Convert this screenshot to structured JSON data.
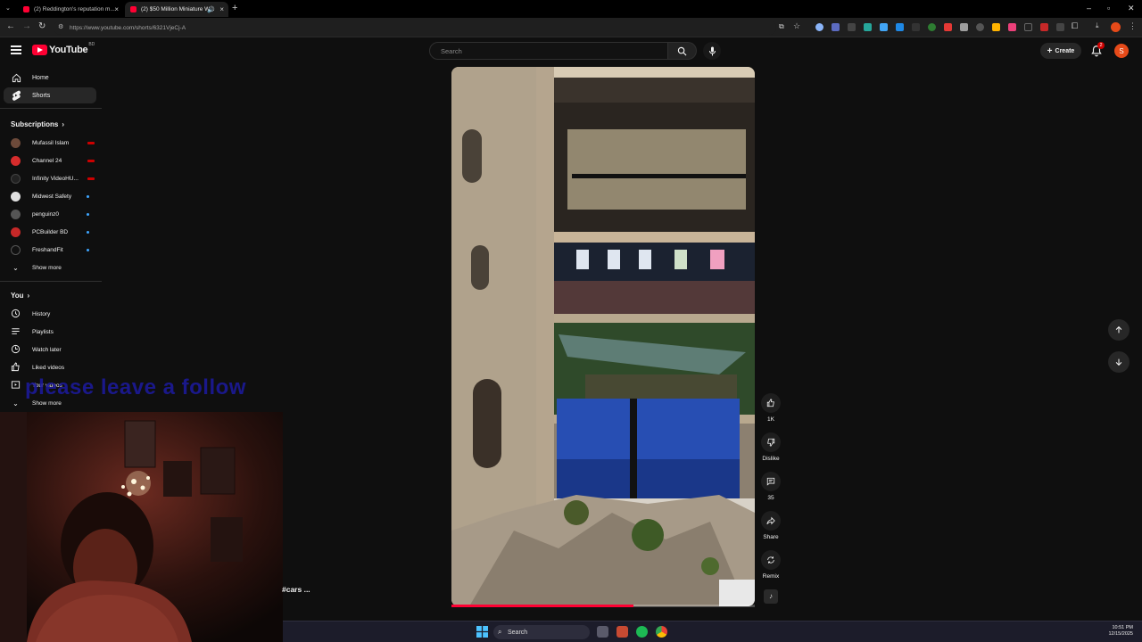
{
  "browser": {
    "tabs": [
      {
        "title": "(2) Reddington's reputation m...",
        "active": false
      },
      {
        "title": "(2) $50 Million Miniature W...",
        "active": true
      }
    ],
    "url": "https://www.youtube.com/shorts/6321VjeCj-A"
  },
  "masthead": {
    "logo_text": "YouTube",
    "country_code": "BD",
    "search_placeholder": "Search",
    "create_label": "Create",
    "notification_count": "2",
    "avatar_letter": "S"
  },
  "sidebar": {
    "main": [
      {
        "label": "Home",
        "icon": "home-icon",
        "active": false
      },
      {
        "label": "Shorts",
        "icon": "shorts-icon",
        "active": true
      }
    ],
    "subscriptions_title": "Subscriptions",
    "subscriptions": [
      {
        "name": "Mufassil Islam",
        "indicator": "live",
        "color": "#6d4a3a"
      },
      {
        "name": "Channel 24",
        "indicator": "live",
        "color": "#d62c2c"
      },
      {
        "name": "Infinity VideoHU...",
        "indicator": "live",
        "color": "#222222"
      },
      {
        "name": "Midwest Safety",
        "indicator": "dot",
        "color": "#e0e0e0"
      },
      {
        "name": "penguinz0",
        "indicator": "dot",
        "color": "#555555"
      },
      {
        "name": "PCBuilder BD",
        "indicator": "dot",
        "color": "#c62828"
      },
      {
        "name": "FreshandFit",
        "indicator": "dot",
        "color": "#111111"
      }
    ],
    "subscriptions_more": "Show more",
    "you_title": "You",
    "you_items": [
      {
        "label": "History",
        "icon": "history-icon"
      },
      {
        "label": "Playlists",
        "icon": "playlists-icon"
      },
      {
        "label": "Watch later",
        "icon": "watch-later-icon"
      },
      {
        "label": "Liked videos",
        "icon": "thumbs-up-icon"
      },
      {
        "label": "Your videos",
        "icon": "your-videos-icon"
      }
    ],
    "you_more": "Show more"
  },
  "overlay_text": "please leave a follow",
  "short": {
    "caption_tag": "#cars ...",
    "progress": 0.6,
    "actions": {
      "like_count": "1K",
      "dislike_label": "Dislike",
      "comments_count": "35",
      "share_label": "Share",
      "remix_label": "Remix"
    }
  },
  "taskbar": {
    "search_label": "Search",
    "time": "10:51 PM",
    "date": "12/15/2025"
  }
}
